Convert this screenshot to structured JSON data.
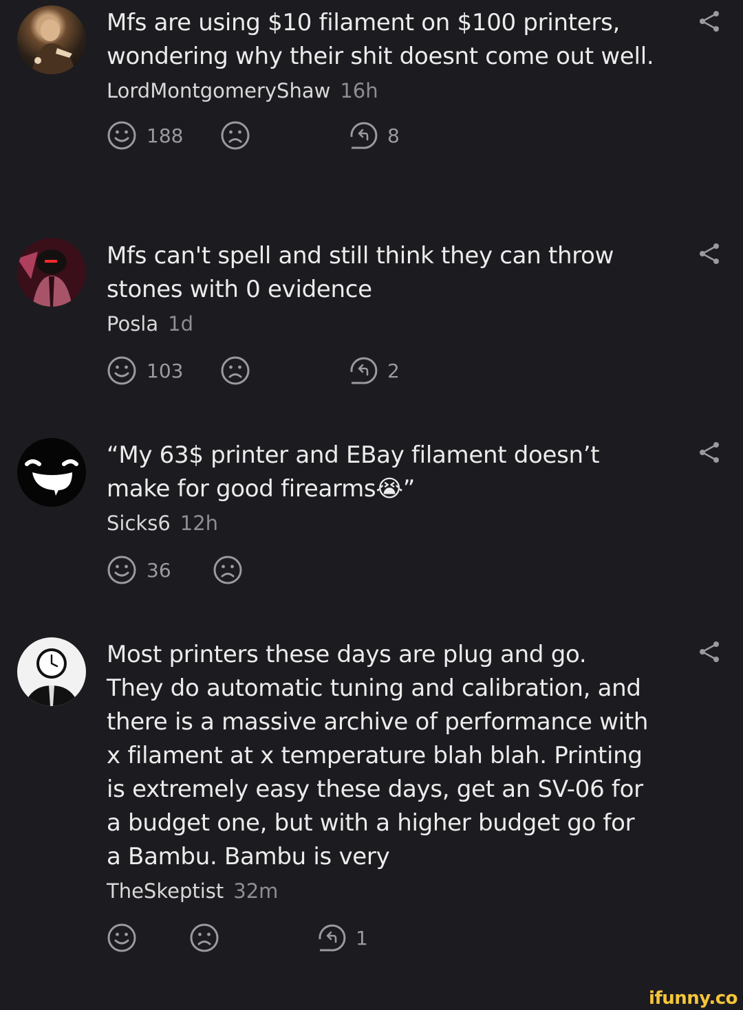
{
  "comments": [
    {
      "text": "Mfs are using $10 filament on $100 printers, wondering why their shit doesnt come out well.",
      "author": "LordMontgomeryShaw",
      "time": "16h",
      "likes": "188",
      "replies": "8",
      "avatar_icon": "portrait-painting-avatar"
    },
    {
      "text": "Mfs can't spell and still think they can throw stones with 0 evidence",
      "author": "Posla",
      "time": "1d",
      "likes": "103",
      "replies": "2",
      "avatar_icon": "red-eyed-character-avatar"
    },
    {
      "text": "“My 63$ printer and EBay filament doesn’t make for good firearms😭”",
      "author": "Sicks6",
      "time": "12h",
      "likes": "36",
      "replies": "",
      "avatar_icon": "grinning-face-avatar"
    },
    {
      "text": "Most printers these days are plug and go. They do automatic tuning and calibration, and there is a massive archive of performance with x filament at x temperature blah blah. Printing is extremely easy these days, get an SV-06 for a budget one, but with a higher budget go for a Bambu. Bambu is very",
      "author": "TheSkeptist",
      "time": "32m",
      "likes": "",
      "replies": "1",
      "avatar_icon": "clock-head-avatar"
    }
  ],
  "watermark": "ifunny.co",
  "colors": {
    "background": "#1c1c20",
    "text": "#ececec",
    "muted": "#8d8d93",
    "icon": "#9a9aa0",
    "watermark": "#f6c53a"
  }
}
